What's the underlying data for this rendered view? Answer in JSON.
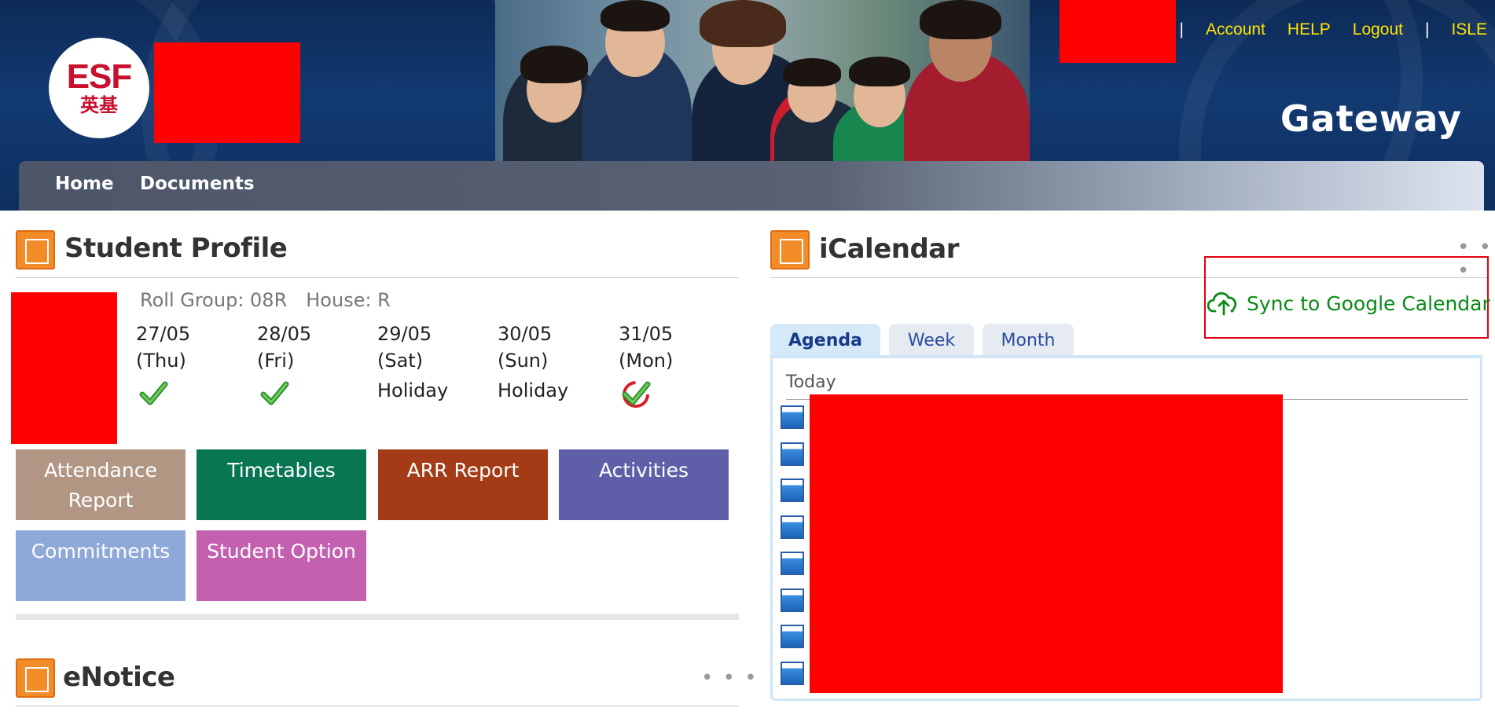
{
  "header": {
    "logo_text": "ESF",
    "logo_chinese": "英基",
    "links": [
      "Account",
      "HELP",
      "Logout",
      "ISLE"
    ],
    "separator": "|",
    "portal_name": "Gateway"
  },
  "nav": {
    "items": [
      "Home",
      "Documents"
    ]
  },
  "student_profile": {
    "title": "Student Profile",
    "roll_group_label": "Roll Group: 08R",
    "house_label": "House: R",
    "attendance_days": [
      {
        "date": "27/05",
        "weekday": "(Thu)",
        "status": "present",
        "status_text": ""
      },
      {
        "date": "28/05",
        "weekday": "(Fri)",
        "status": "present",
        "status_text": ""
      },
      {
        "date": "29/05",
        "weekday": "(Sat)",
        "status": "holiday",
        "status_text": "Holiday"
      },
      {
        "date": "30/05",
        "weekday": "(Sun)",
        "status": "holiday",
        "status_text": "Holiday"
      },
      {
        "date": "31/05",
        "weekday": "(Mon)",
        "status": "today-present",
        "status_text": ""
      }
    ],
    "tiles": [
      {
        "label": "Attendance Report",
        "color": "#b09683"
      },
      {
        "label": "Timetables",
        "color": "#087553"
      },
      {
        "label": "ARR Report",
        "color": "#a33b16"
      },
      {
        "label": "Activities",
        "color": "#5f5ea8"
      },
      {
        "label": "Commitments",
        "color": "#8ea8d7"
      },
      {
        "label": "Student Option",
        "color": "#c460b0"
      }
    ]
  },
  "enotice": {
    "title": "eNotice",
    "more": "• • •"
  },
  "icalendar": {
    "title": "iCalendar",
    "more": "• • •",
    "sync_label": "Sync to Google Calendar",
    "tabs": [
      {
        "label": "Agenda",
        "active": true
      },
      {
        "label": "Week",
        "active": false
      },
      {
        "label": "Month",
        "active": false
      }
    ],
    "today_label": "Today"
  },
  "colors": {
    "header_bg": "#0e2f60",
    "top_link": "#ffe300",
    "sync_green": "#0a8a16",
    "redaction": "#ff0000"
  }
}
